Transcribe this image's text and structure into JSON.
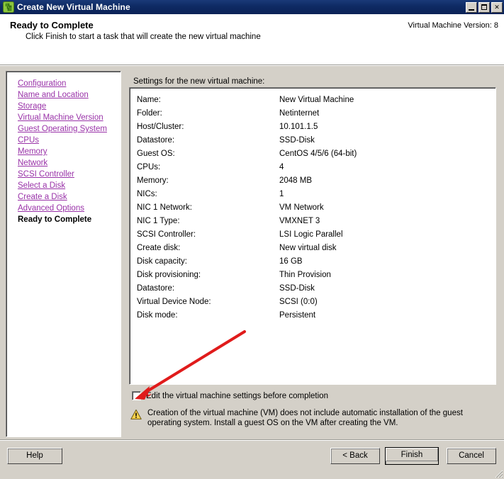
{
  "window": {
    "title": "Create New Virtual Machine",
    "icon": "vm-box-icon",
    "controls": [
      {
        "name": "minimize",
        "label": "_"
      },
      {
        "name": "maximize",
        "label": "□"
      },
      {
        "name": "close",
        "label": "✕"
      }
    ],
    "titlebar_color": "#0e2a63",
    "dialog_bg_color": "#d4d0c8"
  },
  "header": {
    "title": "Ready to Complete",
    "subtitle": "Click Finish to start a task that will create the new virtual machine",
    "version_label": "Virtual Machine Version: 8"
  },
  "nav": {
    "items": [
      {
        "label": "Configuration",
        "current": false
      },
      {
        "label": "Name and Location",
        "current": false
      },
      {
        "label": "Storage",
        "current": false
      },
      {
        "label": "Virtual Machine Version",
        "current": false
      },
      {
        "label": "Guest Operating System",
        "current": false
      },
      {
        "label": "CPUs",
        "current": false
      },
      {
        "label": "Memory",
        "current": false
      },
      {
        "label": "Network",
        "current": false
      },
      {
        "label": "SCSI Controller",
        "current": false
      },
      {
        "label": "Select a Disk",
        "current": false
      },
      {
        "label": "Create a Disk",
        "current": false
      },
      {
        "label": "Advanced Options",
        "current": false
      },
      {
        "label": "Ready to Complete",
        "current": true
      }
    ],
    "link_color": "#9932a8"
  },
  "settings": {
    "label": "Settings for the new virtual machine:",
    "rows": [
      {
        "key": "Name:",
        "value": "New Virtual Machine"
      },
      {
        "key": "Folder:",
        "value": "Netinternet"
      },
      {
        "key": "Host/Cluster:",
        "value": "10.101.1.5"
      },
      {
        "key": "Datastore:",
        "value": "SSD-Disk"
      },
      {
        "key": "Guest OS:",
        "value": "CentOS 4/5/6 (64-bit)"
      },
      {
        "key": "CPUs:",
        "value": "4"
      },
      {
        "key": "Memory:",
        "value": "2048 MB"
      },
      {
        "key": "NICs:",
        "value": "1"
      },
      {
        "key": "NIC 1 Network:",
        "value": "VM Network"
      },
      {
        "key": "NIC 1 Type:",
        "value": "VMXNET 3"
      },
      {
        "key": "SCSI Controller:",
        "value": "LSI Logic Parallel"
      },
      {
        "key": "Create disk:",
        "value": "New virtual disk"
      },
      {
        "key": "Disk capacity:",
        "value": "16 GB"
      },
      {
        "key": "Disk provisioning:",
        "value": "Thin Provision"
      },
      {
        "key": "Datastore:",
        "value": "SSD-Disk"
      },
      {
        "key": "Virtual Device Node:",
        "value": "SCSI (0:0)"
      },
      {
        "key": "Disk mode:",
        "value": "Persistent"
      }
    ]
  },
  "edit_option": {
    "label": "Edit the virtual machine settings before completion",
    "checked": false
  },
  "warning": {
    "icon": "warning-triangle-icon",
    "icon_color": "#ffd24a",
    "text": "Creation of the virtual machine (VM) does not include automatic installation of the guest operating system. Install a guest OS on the VM after creating the VM."
  },
  "footer": {
    "help_label": "Help",
    "back_label": "< Back",
    "finish_label": "Finish",
    "cancel_label": "Cancel"
  },
  "annotation": {
    "arrow_color": "#e01b1b",
    "points_to": "edit-settings-checkbox"
  }
}
